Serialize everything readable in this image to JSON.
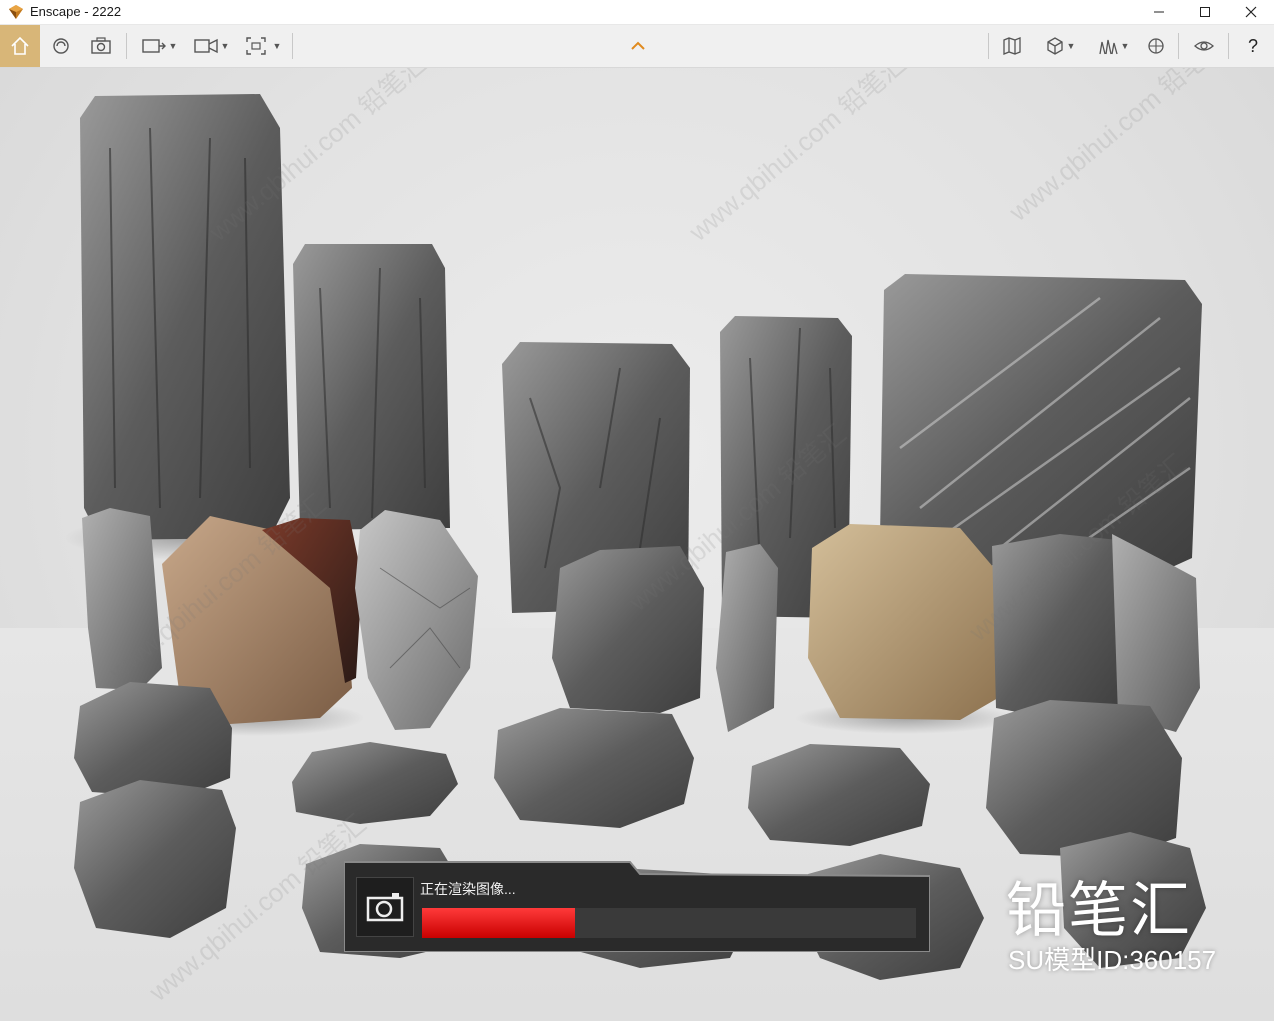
{
  "window": {
    "title": "Enscape - 2222",
    "controls": [
      "minimize-icon",
      "maximize-icon",
      "close-icon"
    ]
  },
  "toolbar": {
    "left_tools": [
      "home-icon",
      "rotate-view-icon",
      "screenshot-icon",
      "view-management-icon",
      "video-editor-icon",
      "batch-render-icon"
    ],
    "center_tool": "collapse-chevron-icon",
    "right_tools": [
      "map-icon",
      "asset-library-icon",
      "people-icon",
      "visual-settings-icon",
      "vr-icon",
      "help-icon"
    ],
    "help_label": "?",
    "active": "home-icon",
    "accent_color": "#d8b678"
  },
  "render": {
    "status_text": "正在渲染图像...",
    "progress": 0.31,
    "progress_color": "#e01010"
  },
  "overlay": {
    "brand": "铅笔汇",
    "model_id": "SU模型ID:360157",
    "watermark_text": "www.qbihui.com  铅笔汇"
  }
}
